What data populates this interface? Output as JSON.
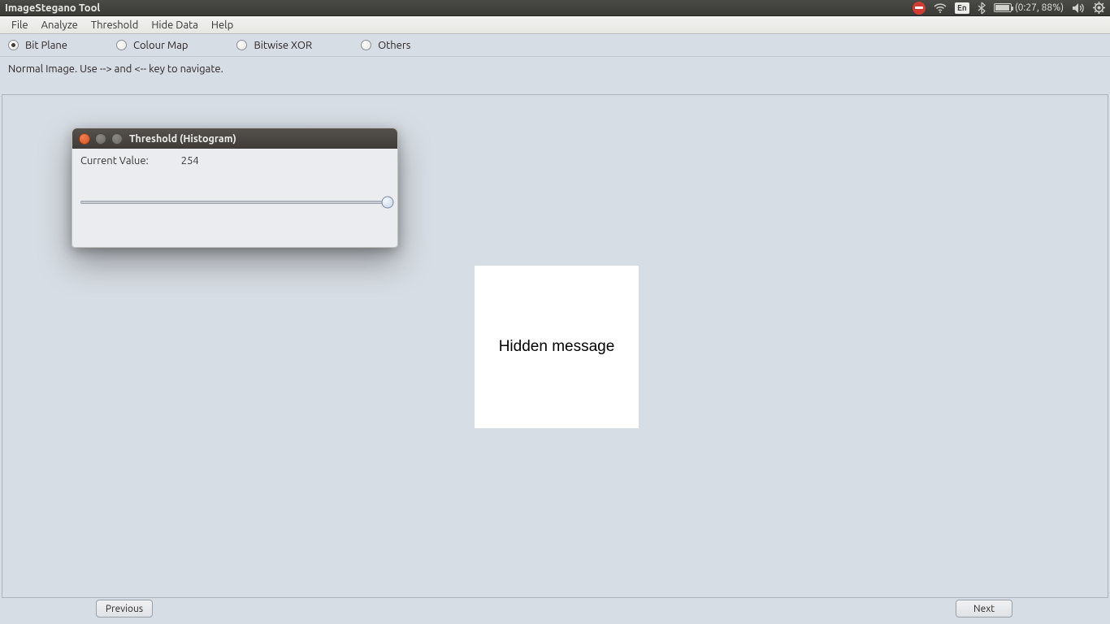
{
  "titlebar": {
    "app_title": "ImageStegano Tool",
    "lang": "En",
    "battery_text": "(0:27, 88%)"
  },
  "menubar": {
    "items": [
      "File",
      "Analyze",
      "Threshold",
      "Hide Data",
      "Help"
    ]
  },
  "radios": {
    "options": [
      {
        "label": "Bit Plane",
        "checked": true
      },
      {
        "label": "Colour Map",
        "checked": false
      },
      {
        "label": "Bitwise XOR",
        "checked": false
      },
      {
        "label": "Others",
        "checked": false
      }
    ]
  },
  "hint": "Normal Image. Use --> and <-- key to navigate.",
  "image": {
    "text": "Hidden message"
  },
  "buttons": {
    "previous": "Previous",
    "next": "Next"
  },
  "dialog": {
    "title": "Threshold (Histogram)",
    "label": "Current Value:",
    "value": "254",
    "slider_percent": 99.6
  }
}
